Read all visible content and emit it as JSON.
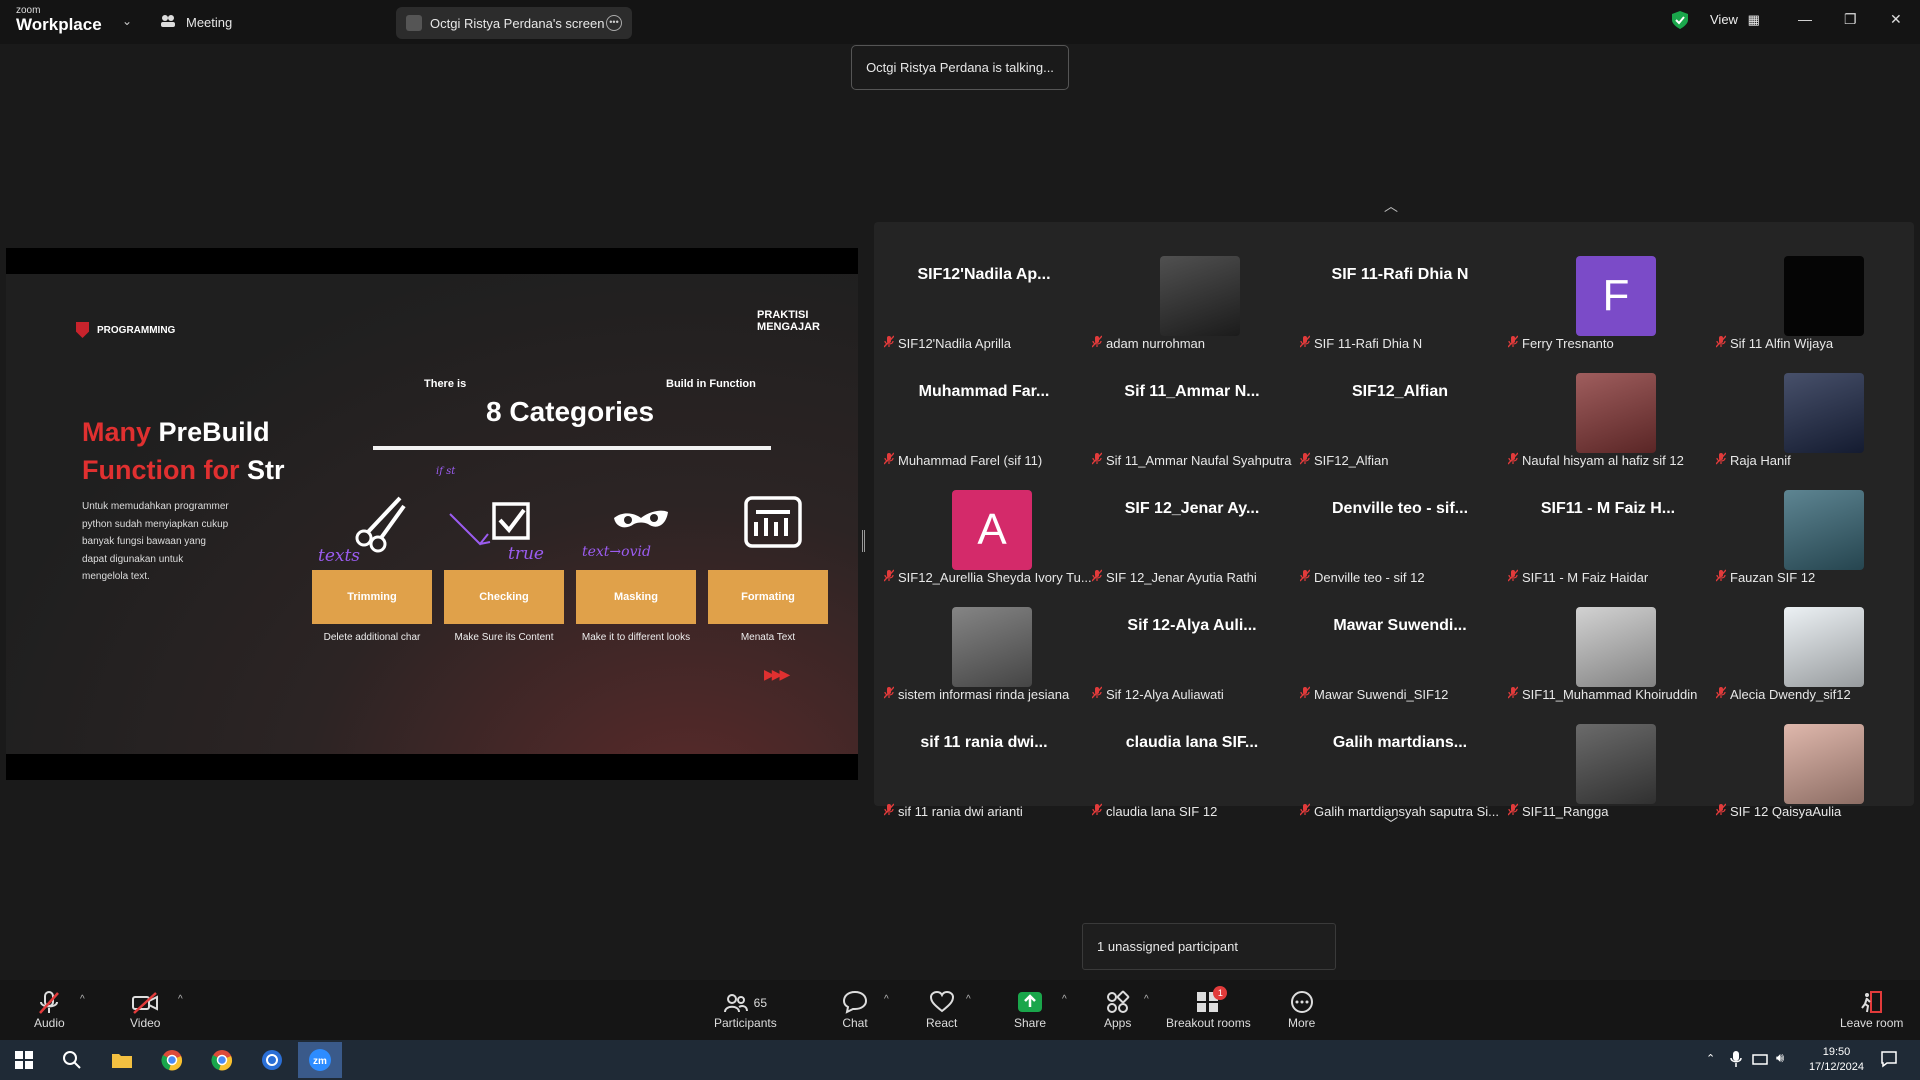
{
  "titlebar": {
    "logo_small": "zoom",
    "logo_main": "Workplace",
    "meeting_label": "Meeting",
    "screen_share_label": "Octgi Ristya Perdana's screen",
    "view_label": "View"
  },
  "talking_indicator": "Octgi Ristya Perdana is talking...",
  "slide": {
    "brand": "PROGRAMMING",
    "logo_line1": "PRAKTISI",
    "logo_line2": "MENGAJAR",
    "title_red1": "Many",
    "title_white1": "PreBuild",
    "title_red2": "Function for",
    "title_white2": "Str",
    "description": "Untuk memudahkan programmer python sudah menyiapkan cukup banyak fungsi bawaan yang dapat digunakan untuk mengelola text.",
    "there_is": "There is",
    "build_in": "Build in Function",
    "heading": "8 Categories",
    "categories": [
      {
        "label": "Trimming",
        "caption": "Delete additional char",
        "icon": "scissors-icon"
      },
      {
        "label": "Checking",
        "caption": "Make Sure its Content",
        "icon": "checkbox-icon"
      },
      {
        "label": "Masking",
        "caption": "Make it to different looks",
        "icon": "mask-icon"
      },
      {
        "label": "Formating",
        "caption": "Menata Text",
        "icon": "format-panel-icon"
      }
    ],
    "annotations": [
      "texts",
      "true",
      "text→ovid",
      "if st"
    ],
    "arrows": "▶▶▶"
  },
  "gallery": {
    "tiles": [
      {
        "big": "SIF12'Nadila Ap...",
        "label": "SIF12'Nadila Aprilla"
      },
      {
        "avatar": "photo",
        "color": "#2a2a2a",
        "label": "adam nurrohman"
      },
      {
        "big": "SIF 11-Rafi Dhia N",
        "label": "SIF 11-Rafi Dhia N"
      },
      {
        "letter": "F",
        "color": "#7b4bc8",
        "label": "Ferry Tresnanto"
      },
      {
        "avatar": "black",
        "color": "#050505",
        "label": "Sif 11 Alfin Wijaya"
      },
      {
        "big": "Muhammad Far...",
        "label": "Muhammad Farel (sif 11)"
      },
      {
        "big": "Sif 11_Ammar N...",
        "label": "Sif 11_Ammar Naufal Syahputra"
      },
      {
        "big": "SIF12_Alfian",
        "label": "SIF12_Alfian"
      },
      {
        "avatar": "photo",
        "color": "#8a3a3a",
        "label": "Naufal hisyam al hafiz sif 12"
      },
      {
        "avatar": "photo",
        "color": "#1f2a4a",
        "label": "Raja Hanif"
      },
      {
        "letter": "A",
        "color": "#d42a6a",
        "label": "SIF12_Aurellia Sheyda Ivory Tu..."
      },
      {
        "big": "SIF 12_Jenar Ay...",
        "label": "SIF 12_Jenar Ayutia Rathi"
      },
      {
        "big": "Denville teo - sif...",
        "label": "Denville teo - sif 12"
      },
      {
        "big": "SIF11 - M Faiz H...",
        "label": "SIF11 - M Faiz Haidar"
      },
      {
        "avatar": "photo",
        "color": "#3a6a7a",
        "label": "Fauzan SIF 12"
      },
      {
        "avatar": "photo",
        "color": "#6a6a6a",
        "label": "sistem informasi rinda jesiana"
      },
      {
        "big": "Sif 12-Alya Auli...",
        "label": "Sif 12-Alya Auliawati"
      },
      {
        "big": "Mawar Suwendi...",
        "label": "Mawar Suwendi_SIF12"
      },
      {
        "avatar": "photo",
        "color": "#c8c8c8",
        "label": "SIF11_Muhammad Khoiruddin"
      },
      {
        "avatar": "photo",
        "color": "#e8eef2",
        "label": "Alecia Dwendy_sif12"
      },
      {
        "big": "sif 11 rania dwi...",
        "label": "sif 11 rania dwi arianti"
      },
      {
        "big": "claudia lana SIF...",
        "label": "claudia lana SIF 12"
      },
      {
        "big": "Galih martdians...",
        "label": "Galih martdiansyah saputra Si..."
      },
      {
        "avatar": "photo",
        "color": "#4a4a4a",
        "label": "SIF11_Rangga"
      },
      {
        "avatar": "photo",
        "color": "#d8a89a",
        "label": "SIF 12 QaisyaAulia"
      }
    ]
  },
  "unassigned": "1 unassigned participant",
  "toolbar": {
    "audio": "Audio",
    "video": "Video",
    "participants": "Participants",
    "participants_count": "65",
    "chat": "Chat",
    "react": "React",
    "share": "Share",
    "apps": "Apps",
    "breakout": "Breakout rooms",
    "breakout_badge": "1",
    "more": "More",
    "leave": "Leave room"
  },
  "taskbar": {
    "time": "19:50",
    "date": "17/12/2024"
  },
  "colors": {
    "accent_orange": "#e0a14a",
    "slide_red": "#e03030",
    "share_green": "#1aa64b",
    "mute_red": "#e23b3b"
  }
}
